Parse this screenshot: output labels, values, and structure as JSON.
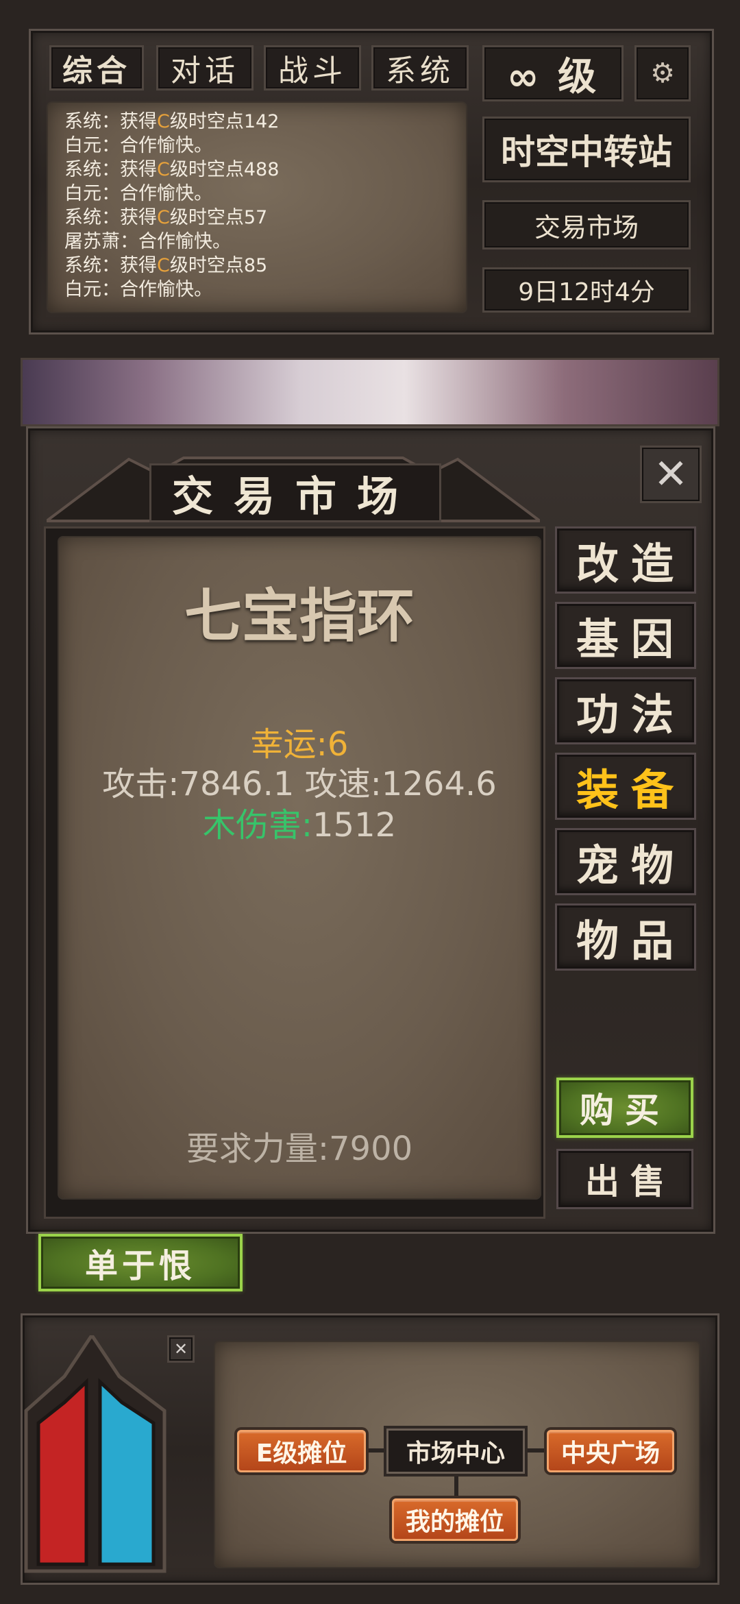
{
  "top_tabs": [
    "综合",
    "对话",
    "战斗",
    "系统"
  ],
  "level_label": "∞ 级",
  "chat_lines": [
    {
      "pre": "系统：获得",
      "mark": "C",
      "post": "级时空点142"
    },
    {
      "pre": "白元：合作愉快。",
      "mark": "",
      "post": ""
    },
    {
      "pre": "系统：获得",
      "mark": "C",
      "post": "级时空点488"
    },
    {
      "pre": "白元：合作愉快。",
      "mark": "",
      "post": ""
    },
    {
      "pre": "系统：获得",
      "mark": "C",
      "post": "级时空点57"
    },
    {
      "pre": "屠苏萧：合作愉快。",
      "mark": "",
      "post": ""
    },
    {
      "pre": "系统：获得",
      "mark": "C",
      "post": "级时空点85"
    },
    {
      "pre": "白元：合作愉快。",
      "mark": "",
      "post": ""
    }
  ],
  "right_panel": {
    "station": "时空中转站",
    "location": "交易市场",
    "time": "9日12时4分"
  },
  "dialog": {
    "title": "交易市场",
    "item_name": "七宝指环",
    "stat_luck": "幸运:6",
    "stat_attack": "攻击:7846.1 攻速:1264.6",
    "stat_wood_label": "木伤害:",
    "stat_wood_value": "1512",
    "requirement": "要求力量:7900",
    "categories": [
      "改造",
      "基因",
      "功法",
      "装备",
      "宠物",
      "物品"
    ],
    "active_category": "装备",
    "buy": "购买",
    "sell": "出售"
  },
  "player_name_button": "单于恨",
  "map": {
    "e_stall": "E级摊位",
    "market_center": "市场中心",
    "central_square": "中央广场",
    "my_stall": "我的摊位"
  },
  "colors": {
    "luck": "#f0b238",
    "stat": "#d9d0c3",
    "wood": "#37c46a",
    "active_tab": "#ffc21a",
    "hp": "#c42424",
    "mp": "#29a9cf"
  }
}
